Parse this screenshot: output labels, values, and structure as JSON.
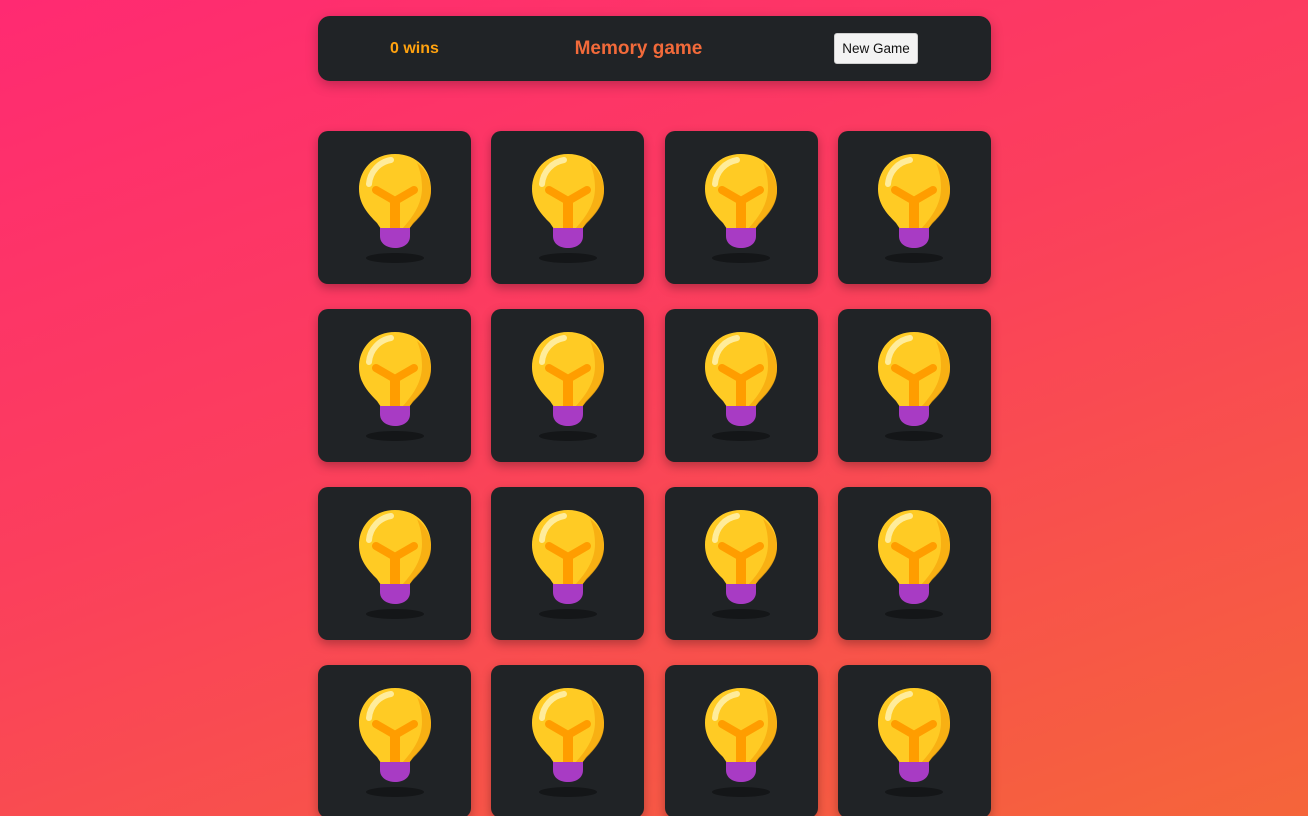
{
  "header": {
    "wins_text": "0 wins",
    "title": "Memory game",
    "new_game_label": "New Game"
  },
  "colors": {
    "background_start": "#ff2a72",
    "background_end": "#f5653a",
    "panel": "#202326",
    "wins_text": "#ffa20f",
    "title_text": "#f26a3a",
    "bulb_glass": "#ffcb24",
    "bulb_filament": "#ff9d00",
    "bulb_base": "#a83bc4"
  },
  "board": {
    "rows": 4,
    "columns": 4,
    "cards": [
      {
        "state": "face-down",
        "icon": "lightbulb-icon"
      },
      {
        "state": "face-down",
        "icon": "lightbulb-icon"
      },
      {
        "state": "face-down",
        "icon": "lightbulb-icon"
      },
      {
        "state": "face-down",
        "icon": "lightbulb-icon"
      },
      {
        "state": "face-down",
        "icon": "lightbulb-icon"
      },
      {
        "state": "face-down",
        "icon": "lightbulb-icon"
      },
      {
        "state": "face-down",
        "icon": "lightbulb-icon"
      },
      {
        "state": "face-down",
        "icon": "lightbulb-icon"
      },
      {
        "state": "face-down",
        "icon": "lightbulb-icon"
      },
      {
        "state": "face-down",
        "icon": "lightbulb-icon"
      },
      {
        "state": "face-down",
        "icon": "lightbulb-icon"
      },
      {
        "state": "face-down",
        "icon": "lightbulb-icon"
      },
      {
        "state": "face-down",
        "icon": "lightbulb-icon"
      },
      {
        "state": "face-down",
        "icon": "lightbulb-icon"
      },
      {
        "state": "face-down",
        "icon": "lightbulb-icon"
      },
      {
        "state": "face-down",
        "icon": "lightbulb-icon"
      }
    ]
  }
}
